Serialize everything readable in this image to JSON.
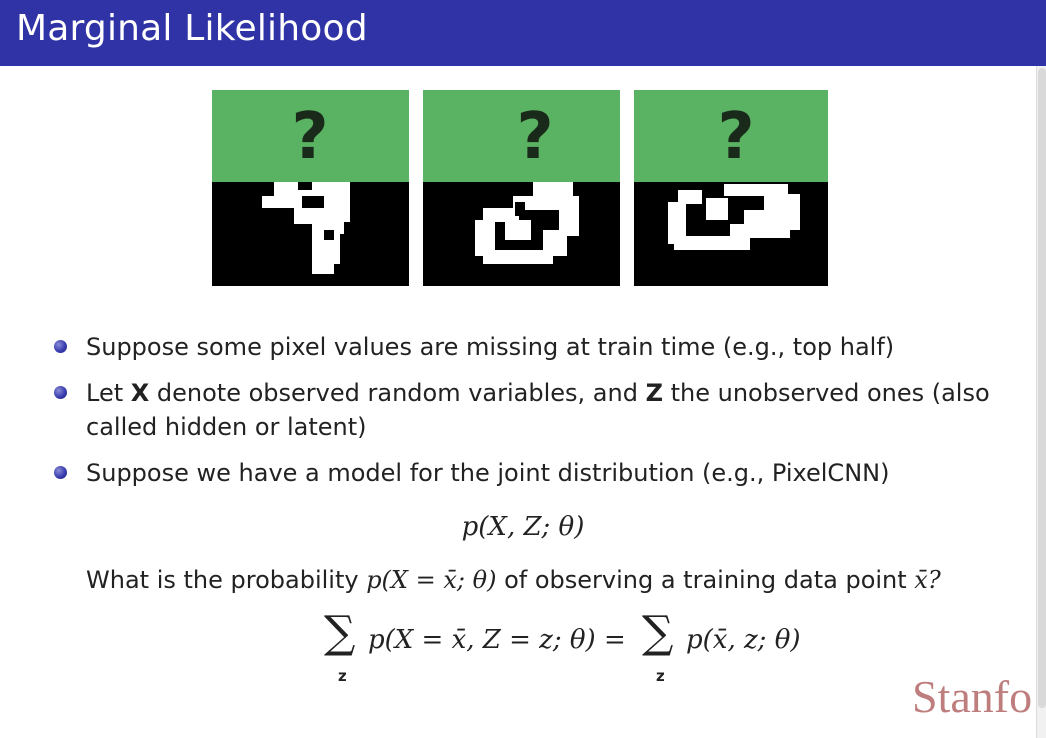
{
  "header": {
    "title": "Marginal Likelihood"
  },
  "figure": {
    "question_mark": "?"
  },
  "bullets": {
    "b1": "Suppose some pixel values are missing at train time (e.g., top half)",
    "b2_pre": "Let ",
    "b2_x": "X",
    "b2_mid": " denote observed random variables, and ",
    "b2_z": "Z",
    "b2_post": " the unobserved ones (also called hidden or latent)",
    "b3": "Suppose we have a model for the joint distribution (e.g., PixelCNN)"
  },
  "equations": {
    "joint": "p(X, Z; θ)",
    "question_pre": "What is the probability ",
    "question_math": "p(X = x̄; θ)",
    "question_post": " of observing a training data point ",
    "question_var": "x̄?",
    "sum_symbol": "∑",
    "sum_sub": "z",
    "marginal_left": "p(X = x̄, Z = z; θ) =",
    "marginal_right": "p(x̄, z; θ)"
  },
  "footer": {
    "logo_text": "Stanfo"
  },
  "colors": {
    "header_bg": "#3033a6",
    "green": "#5ab263",
    "logo": "#8c1515"
  }
}
